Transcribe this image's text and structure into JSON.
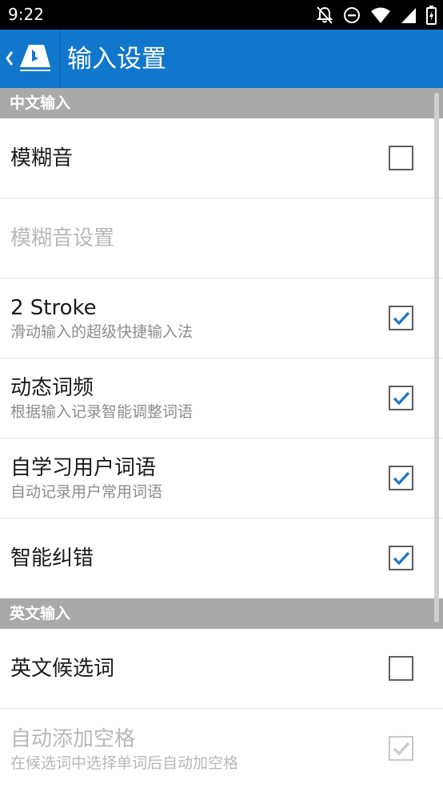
{
  "status_bar": {
    "time": "9:22",
    "icons": [
      "notifications-off-icon",
      "do-not-disturb-icon",
      "wifi-icon",
      "cellular-signal-icon",
      "battery-icon"
    ]
  },
  "app_bar": {
    "title": "输入设置",
    "back_icon": "chevron-left-icon",
    "logo_icon": "bing-keyboard-logo-icon",
    "color": "#1177cc"
  },
  "sections": [
    {
      "header": "中文输入",
      "items": [
        {
          "title": "模糊音",
          "summary": "",
          "checkbox": true,
          "checked": false,
          "enabled": true
        },
        {
          "title": "模糊音设置",
          "summary": "",
          "checkbox": false,
          "checked": false,
          "enabled": false
        },
        {
          "title": "2 Stroke",
          "summary": "滑动输入的超级快捷输入法",
          "checkbox": true,
          "checked": true,
          "enabled": true
        },
        {
          "title": "动态词频",
          "summary": "根据输入记录智能调整词语",
          "checkbox": true,
          "checked": true,
          "enabled": true
        },
        {
          "title": "自学习用户词语",
          "summary": "自动记录用户常用词语",
          "checkbox": true,
          "checked": true,
          "enabled": true
        },
        {
          "title": "智能纠错",
          "summary": "",
          "checkbox": true,
          "checked": true,
          "enabled": true
        }
      ]
    },
    {
      "header": "英文输入",
      "items": [
        {
          "title": "英文候选词",
          "summary": "",
          "checkbox": true,
          "checked": false,
          "enabled": true
        },
        {
          "title": "自动添加空格",
          "summary": "在候选词中选择单词后自动加空格",
          "checkbox": true,
          "checked": true,
          "enabled": false
        }
      ]
    }
  ],
  "colors": {
    "accent": "#1177cc",
    "check": "#1a73c8",
    "section_header": "#a9a9a9"
  }
}
